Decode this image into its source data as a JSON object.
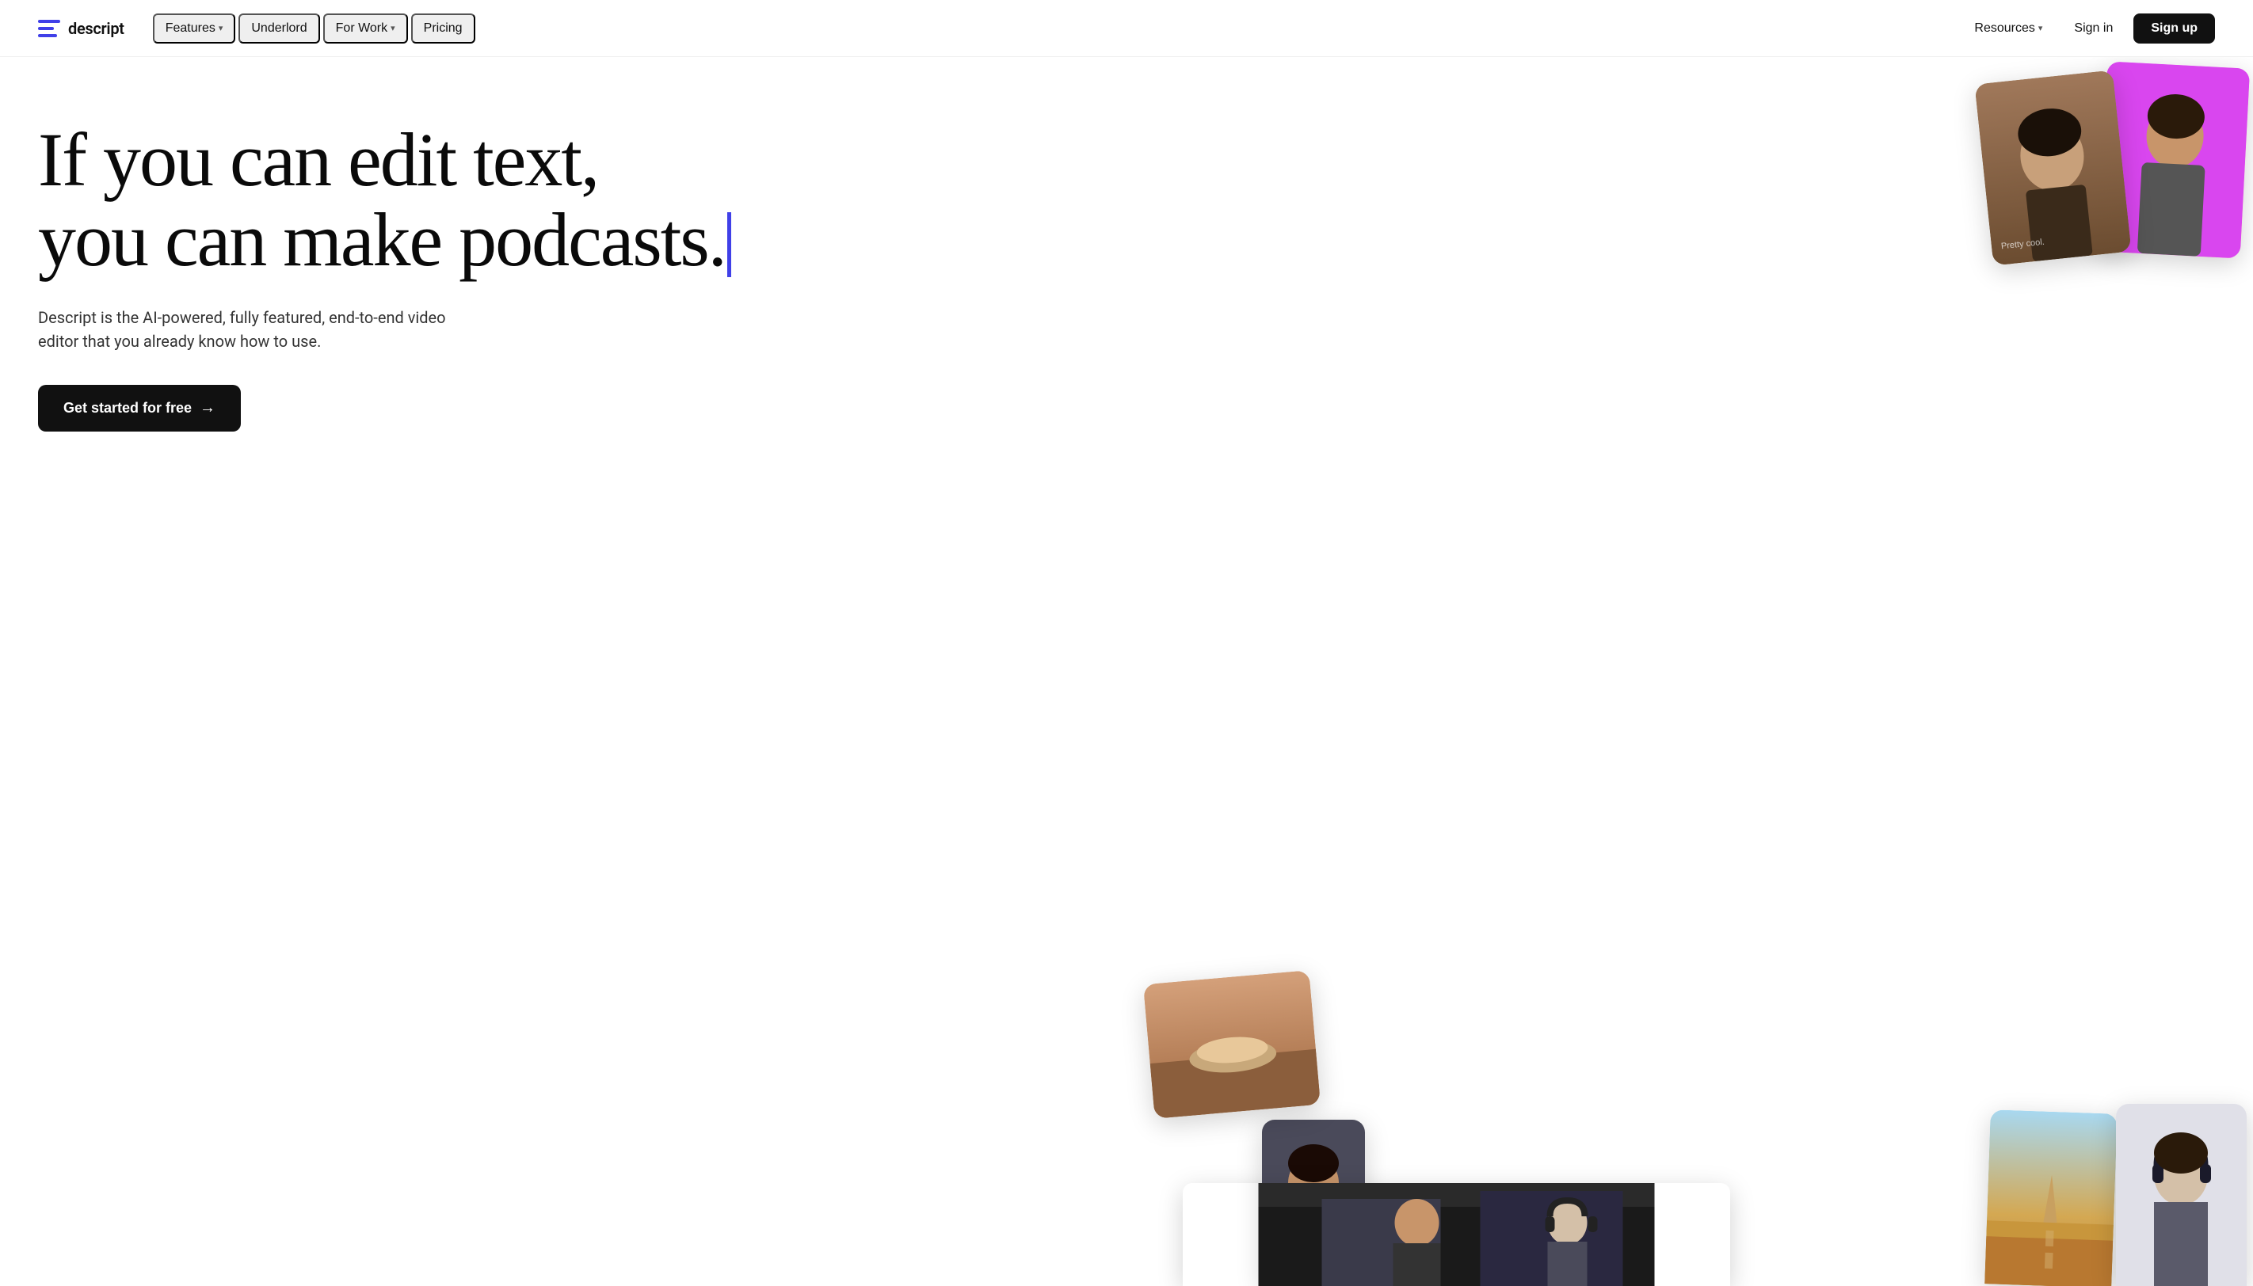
{
  "brand": {
    "name": "descript",
    "logo_alt": "Descript logo"
  },
  "nav": {
    "features_label": "Features",
    "underlord_label": "Underlord",
    "for_work_label": "For Work",
    "pricing_label": "Pricing",
    "resources_label": "Resources",
    "signin_label": "Sign in",
    "signup_label": "Sign up"
  },
  "hero": {
    "headline_line1": "If you can edit text,",
    "headline_line2": "you can make podcasts.",
    "subtext": "Descript is the AI-powered, fully featured, end-to-end video editor that you already know how to use.",
    "cta_label": "Get started for free",
    "cta_arrow": "→"
  },
  "colors": {
    "accent": "#4040e8",
    "bg": "#ffffff",
    "text_dark": "#0a0a0a",
    "text_medium": "#333333",
    "btn_bg": "#111111",
    "btn_text": "#ffffff"
  }
}
